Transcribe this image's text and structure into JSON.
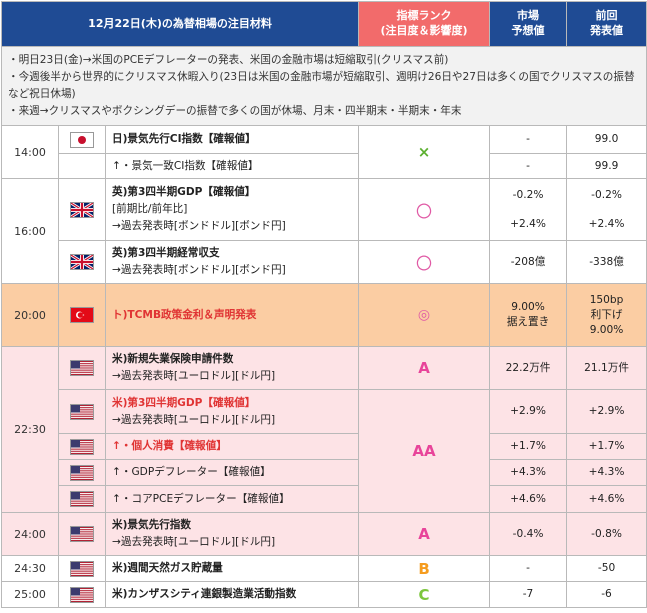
{
  "header": {
    "title": "12月22日(木)の為替相場の注目材料",
    "rank_line1": "指標ランク",
    "rank_line2": "(注目度＆影響度)",
    "forecast_line1": "市場",
    "forecast_line2": "予想値",
    "previous_line1": "前回",
    "previous_line2": "発表値"
  },
  "notes": [
    "・明日23日(金)→米国のPCEデフレーターの発表、米国の金融市場は短縮取引(クリスマス前)",
    "・今週後半から世界的にクリスマス休暇入り(23日は米国の金融市場が短縮取引、週明け26日や27日は多くの国でクリスマスの振替など祝日休場)",
    "・来週→クリスマスやボクシングデーの振替で多くの国が休場、月末・四半期末・半期末・年末"
  ],
  "rows": [
    {
      "time": "14:00",
      "flag": "japan-flag",
      "lines": [
        "日)景気先行CI指数【確報値】"
      ],
      "rank": "×",
      "forecast": "-",
      "previous": "99.0"
    },
    {
      "lines": [
        "↑・景気一致CI指数【確報値】"
      ],
      "forecast": "-",
      "previous": "99.9"
    },
    {
      "time": "16:00",
      "flag": "uk-flag",
      "lines": [
        "英)第3四半期GDP【確報値】",
        "[前期比/前年比]",
        "→過去発表時[ボンドドル][ボンド円]"
      ],
      "rank": "〇",
      "forecast": "-0.2%",
      "forecast2": "+2.4%",
      "previous": "-0.2%",
      "previous2": "+2.4%"
    },
    {
      "flag": "uk-flag",
      "lines": [
        "英)第3四半期経常収支",
        "→過去発表時[ボンドドル][ボンド円]"
      ],
      "rank": "〇",
      "forecast": "-208億",
      "previous": "-338億"
    },
    {
      "time": "20:00",
      "flag": "turkey-flag",
      "lines": [
        "ト)TCMB政策金利＆声明発表"
      ],
      "rank": "◎",
      "forecast": "9.00%",
      "forecast2": "据え置き",
      "previous": "150bp",
      "previous2": "利下げ",
      "previous3": "9.00%"
    },
    {
      "time": "22:30",
      "flag": "us-flag",
      "lines": [
        "米)新規失業保険申請件数",
        "→過去発表時[ユーロドル][ドル円]"
      ],
      "rank": "A",
      "forecast": "22.2万件",
      "previous": "21.1万件"
    },
    {
      "flag": "us-flag",
      "lines": [
        "米)第3四半期GDP【確報値】",
        "→過去発表時[ユーロドル][ドル円]"
      ],
      "rank": "AA",
      "forecast": "+2.9%",
      "previous": "+2.9%"
    },
    {
      "flag": "us-flag",
      "lines": [
        "↑・個人消費【確報値】"
      ],
      "forecast": "+1.7%",
      "previous": "+1.7%"
    },
    {
      "flag": "us-flag",
      "lines": [
        "↑・GDPデフレーター【確報値】"
      ],
      "forecast": "+4.3%",
      "previous": "+4.3%"
    },
    {
      "flag": "us-flag",
      "lines": [
        "↑・コアPCEデフレーター【確報値】"
      ],
      "forecast": "+4.6%",
      "previous": "+4.6%"
    },
    {
      "time": "24:00",
      "flag": "us-flag",
      "lines": [
        "米)景気先行指数",
        "→過去発表時[ユーロドル][ドル円]"
      ],
      "rank": "A",
      "forecast": "-0.4%",
      "previous": "-0.8%"
    },
    {
      "time": "24:30",
      "flag": "us-flag",
      "lines": [
        "米)週間天然ガス貯蔵量"
      ],
      "rank": "B",
      "forecast": "-",
      "previous": "-50"
    },
    {
      "time": "25:00",
      "flag": "us-flag",
      "lines": [
        "米)カンザスシティ連銀製造業活動指数"
      ],
      "rank": "C",
      "forecast": "-7",
      "previous": "-6"
    }
  ],
  "colors": {
    "header_blue": "#1f4b94",
    "header_red": "#f26b6b",
    "orange_row": "#fbcda3",
    "pink_row": "#fde3e6"
  }
}
